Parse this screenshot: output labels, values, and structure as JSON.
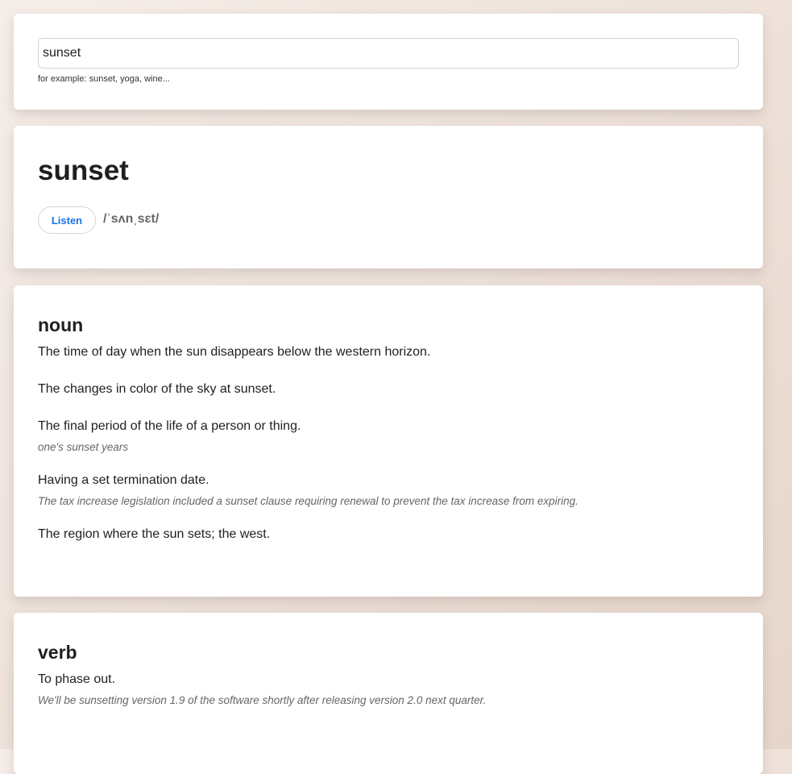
{
  "search": {
    "value": "sunset",
    "hint": "for example: sunset, yoga, wine..."
  },
  "entry": {
    "word": "sunset",
    "listen_label": "Listen",
    "pronunciation": "/ˈsʌnˌsɛt/"
  },
  "noun": {
    "label": "noun",
    "definitions": [
      {
        "text": "The time of day when the sun disappears below the western horizon.",
        "example": null
      },
      {
        "text": "The changes in color of the sky at sunset.",
        "example": null
      },
      {
        "text": "The final period of the life of a person or thing.",
        "example": "one's sunset years"
      },
      {
        "text": "Having a set termination date.",
        "example": "The tax increase legislation included a sunset clause requiring renewal to prevent the tax increase from expiring."
      },
      {
        "text": "The region where the sun sets; the west.",
        "example": null
      }
    ]
  },
  "verb": {
    "label": "verb",
    "definitions": [
      {
        "text": "To phase out.",
        "example": "We'll be sunsetting version 1.9 of the software shortly after releasing version 2.0 next quarter."
      }
    ]
  }
}
